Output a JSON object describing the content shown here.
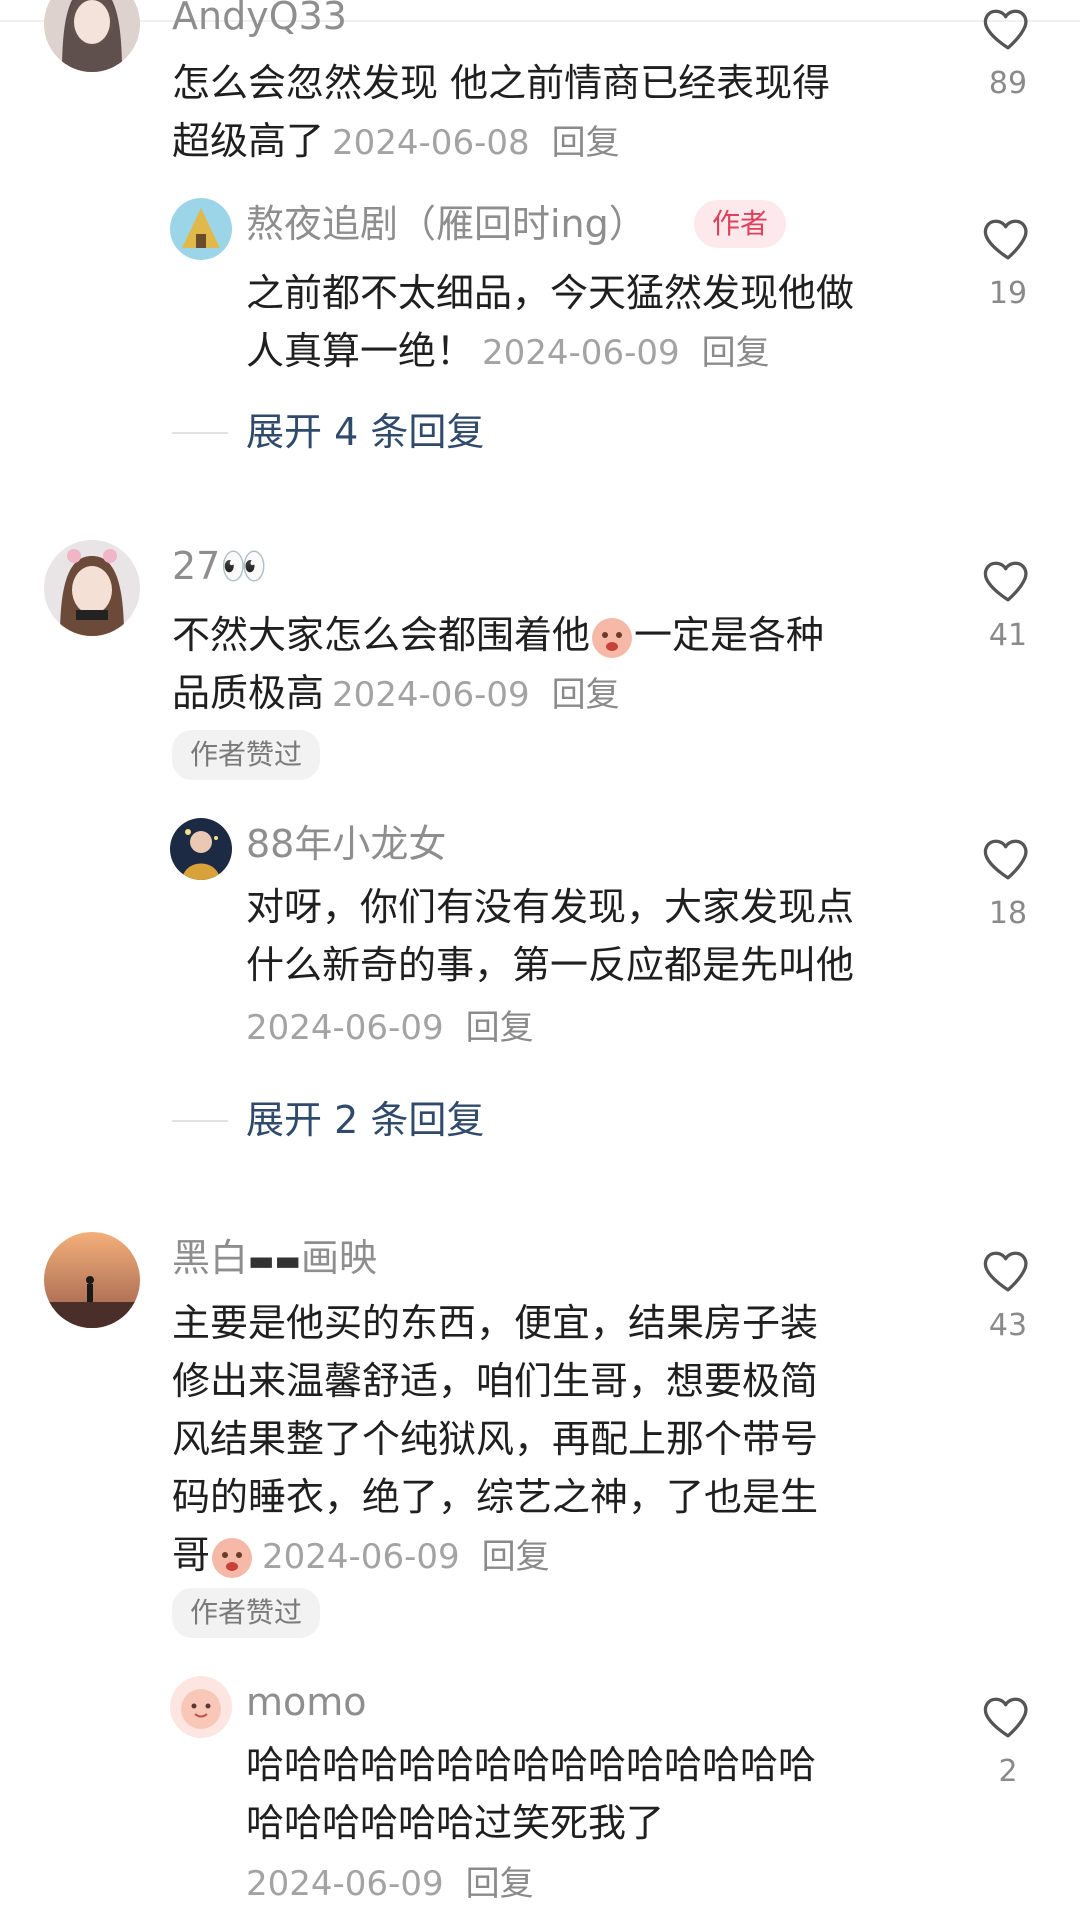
{
  "comments": [
    {
      "user": "AndyQ33",
      "text_line1": "怎么会忽然发现 他之前情商已经表现得",
      "text_line2": "超级高了",
      "date": "2024-06-08",
      "reply_label": "回复",
      "likes": "89"
    },
    {
      "user": "熬夜追剧（雁回时ing）",
      "author_badge": "作者",
      "text_line1": "之前都不太细品，今天猛然发现他做",
      "text_line2": "人真算一绝！",
      "date": "2024-06-09",
      "reply_label": "回复",
      "likes": "19",
      "expand_label": "展开 4 条回复"
    },
    {
      "user": "27",
      "user_emoji": "👀",
      "text_line1a": "不然大家怎么会都围着他",
      "text_line1b": "一定是各种",
      "text_line2": "品质极高",
      "date": "2024-06-09",
      "reply_label": "回复",
      "likes": "41",
      "liked_chip": "作者赞过"
    },
    {
      "user": "88年小龙女",
      "text_line1": "对呀，你们有没有发现，大家发现点",
      "text_line2": "什么新奇的事，第一反应都是先叫他",
      "date": "2024-06-09",
      "reply_label": "回复",
      "likes": "18",
      "expand_label": "展开 2 条回复"
    },
    {
      "user_a": "黑白",
      "user_b": "画映",
      "text_line1": "主要是他买的东西，便宜，结果房子装",
      "text_line2": "修出来温馨舒适，咱们生哥，想要极简",
      "text_line3": "风结果整了个纯狱风，再配上那个带号",
      "text_line4": "码的睡衣，绝了，综艺之神，了也是生",
      "text_line5": "哥",
      "date": "2024-06-09",
      "reply_label": "回复",
      "likes": "43",
      "liked_chip": "作者赞过"
    },
    {
      "user": "momo",
      "text_line1": "哈哈哈哈哈哈哈哈哈哈哈哈哈哈哈",
      "text_line2": "哈哈哈哈哈哈过笑死我了",
      "date": "2024-06-09",
      "reply_label": "回复",
      "likes": "2"
    }
  ],
  "colors": {
    "name": "#8e8e8e",
    "date": "#a3a3a3",
    "expand": "#2f4a6b",
    "author_badge_bg": "#fde9ec",
    "author_badge_fg": "#e0405a"
  },
  "icons": {
    "like": "heart-outline-icon"
  }
}
